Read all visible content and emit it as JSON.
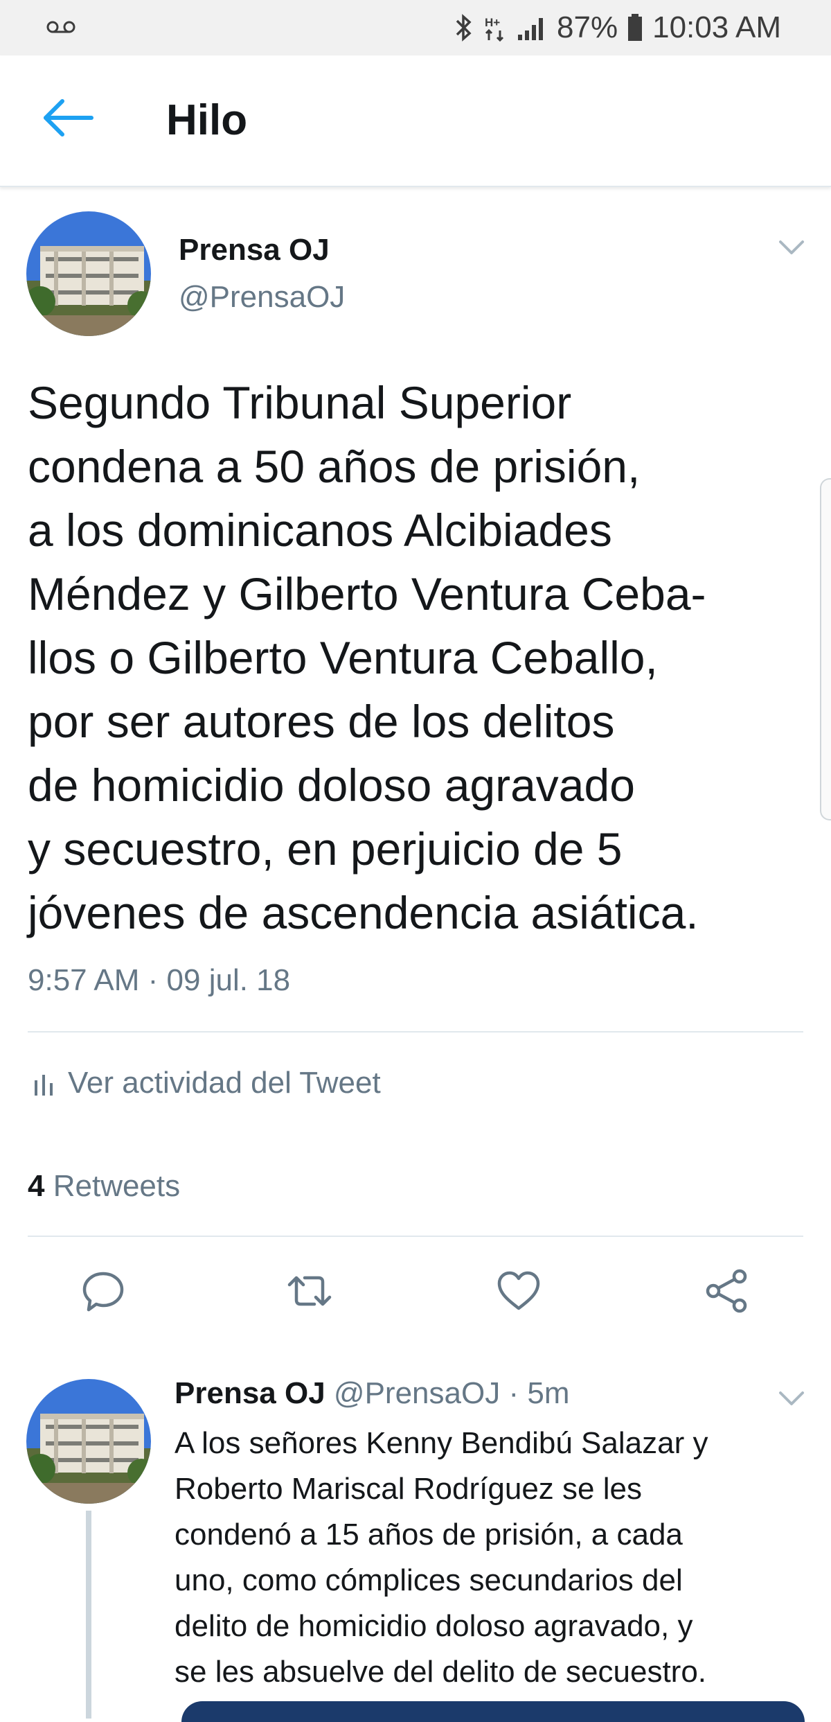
{
  "status_bar": {
    "battery": "87%",
    "time": "10:03 AM",
    "icons": [
      "voicemail-icon",
      "bluetooth-icon",
      "hplus-data-icon",
      "signal-icon",
      "battery-icon"
    ]
  },
  "header": {
    "title": "Hilo",
    "back_icon": "back-arrow-icon"
  },
  "main_tweet": {
    "name": "Prensa OJ",
    "handle": "@PrensaOJ",
    "text": "Segundo Tribunal Superior\ncondena a 50 años de prisión,\na los dominicanos Alcibiades\nMéndez y Gilberto Ventura Ceba-\nllos o Gilberto Ventura Ceballo,\npor ser autores de los delitos\nde homicidio doloso agravado\ny secuestro, en perjuicio de 5\njóvenes de ascendencia asiática.",
    "timestamp": "9:57 AM · 09 jul. 18",
    "activity_label": "Ver actividad del Tweet",
    "retweet_count": "4",
    "retweet_label": "Retweets",
    "actions": [
      "reply-icon",
      "retweet-icon",
      "like-icon",
      "share-icon"
    ]
  },
  "reply_tweet": {
    "name": "Prensa OJ",
    "handle": "@PrensaOJ",
    "age": "· 5m",
    "text": "A los señores Kenny Bendibú Salazar y\nRoberto Mariscal Rodríguez se les\ncondenó a 15 años de prisión, a cada\nuno, como cómplices secundarios del\ndelito de homicidio doloso agravado, y\nse les absuelve del delito de secuestro."
  },
  "colors": {
    "accent": "#1da1f2",
    "text": "#14171a",
    "secondary": "#657786",
    "divider": "#e1e8ed"
  }
}
